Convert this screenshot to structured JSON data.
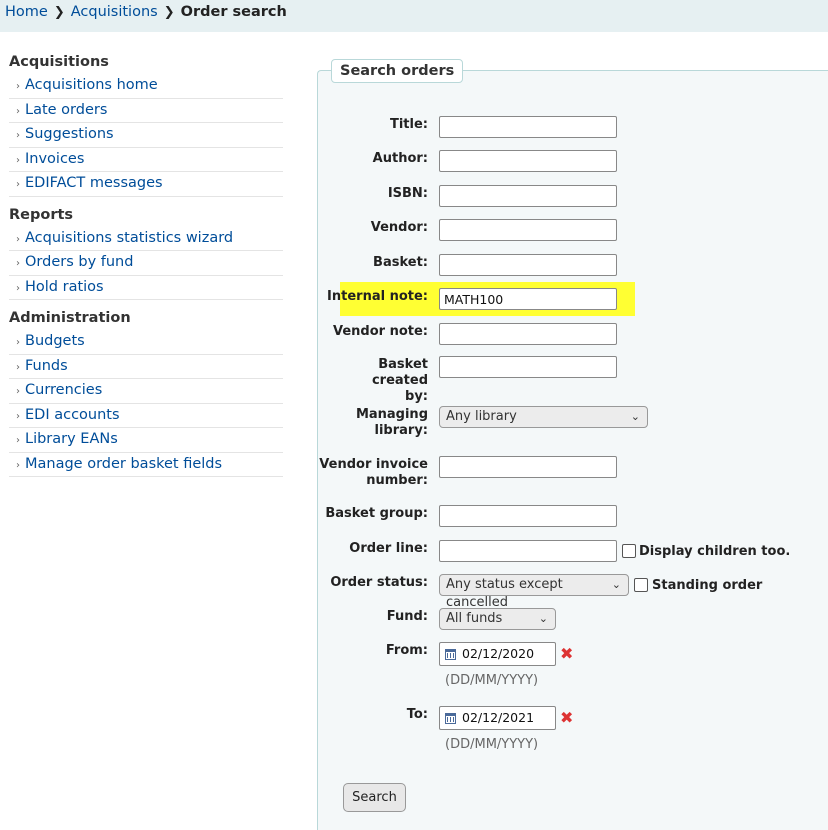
{
  "breadcrumb": {
    "items": [
      "Home",
      "Acquisitions"
    ],
    "current": "Order search",
    "separator": "❯"
  },
  "sidebar": {
    "sections": [
      {
        "title": "Acquisitions",
        "items": [
          "Acquisitions home",
          "Late orders",
          "Suggestions",
          "Invoices",
          "EDIFACT messages"
        ]
      },
      {
        "title": "Reports",
        "items": [
          "Acquisitions statistics wizard",
          "Orders by fund",
          "Hold ratios"
        ]
      },
      {
        "title": "Administration",
        "items": [
          "Budgets",
          "Funds",
          "Currencies",
          "EDI accounts",
          "Library EANs",
          "Manage order basket fields"
        ]
      }
    ]
  },
  "form": {
    "legend": "Search orders",
    "title_label": "Title:",
    "title_value": "",
    "author_label": "Author:",
    "author_value": "",
    "isbn_label": "ISBN:",
    "isbn_value": "",
    "vendor_label": "Vendor:",
    "vendor_value": "",
    "basket_label": "Basket:",
    "basket_value": "",
    "internal_note_label": "Internal note:",
    "internal_note_value": "MATH100",
    "vendor_note_label": "Vendor note:",
    "vendor_note_value": "",
    "basket_created_by_label_1": "Basket created",
    "basket_created_by_label_2": "by:",
    "basket_created_by_value": "",
    "managing_library_label_1": "Managing",
    "managing_library_label_2": "library:",
    "managing_library_value": "Any library",
    "vendor_invoice_label_1": "Vendor invoice",
    "vendor_invoice_label_2": "number:",
    "vendor_invoice_value": "",
    "basket_group_label": "Basket group:",
    "basket_group_value": "",
    "order_line_label": "Order line:",
    "order_line_value": "",
    "display_children_label": "Display children too.",
    "order_status_label": "Order status:",
    "order_status_value": "Any status except cancelled",
    "standing_order_label": "Standing order",
    "fund_label": "Fund:",
    "fund_value": "All funds",
    "from_label": "From:",
    "from_value": "02/12/2020",
    "to_label": "To:",
    "to_value": "02/12/2021",
    "date_hint": "(DD/MM/YYYY)",
    "search_button": "Search",
    "clear_icon": "✖",
    "chevron_icon": "⌄"
  },
  "colors": {
    "highlight": "#ffff33",
    "link": "#004d99",
    "clear": "#dd3333"
  }
}
